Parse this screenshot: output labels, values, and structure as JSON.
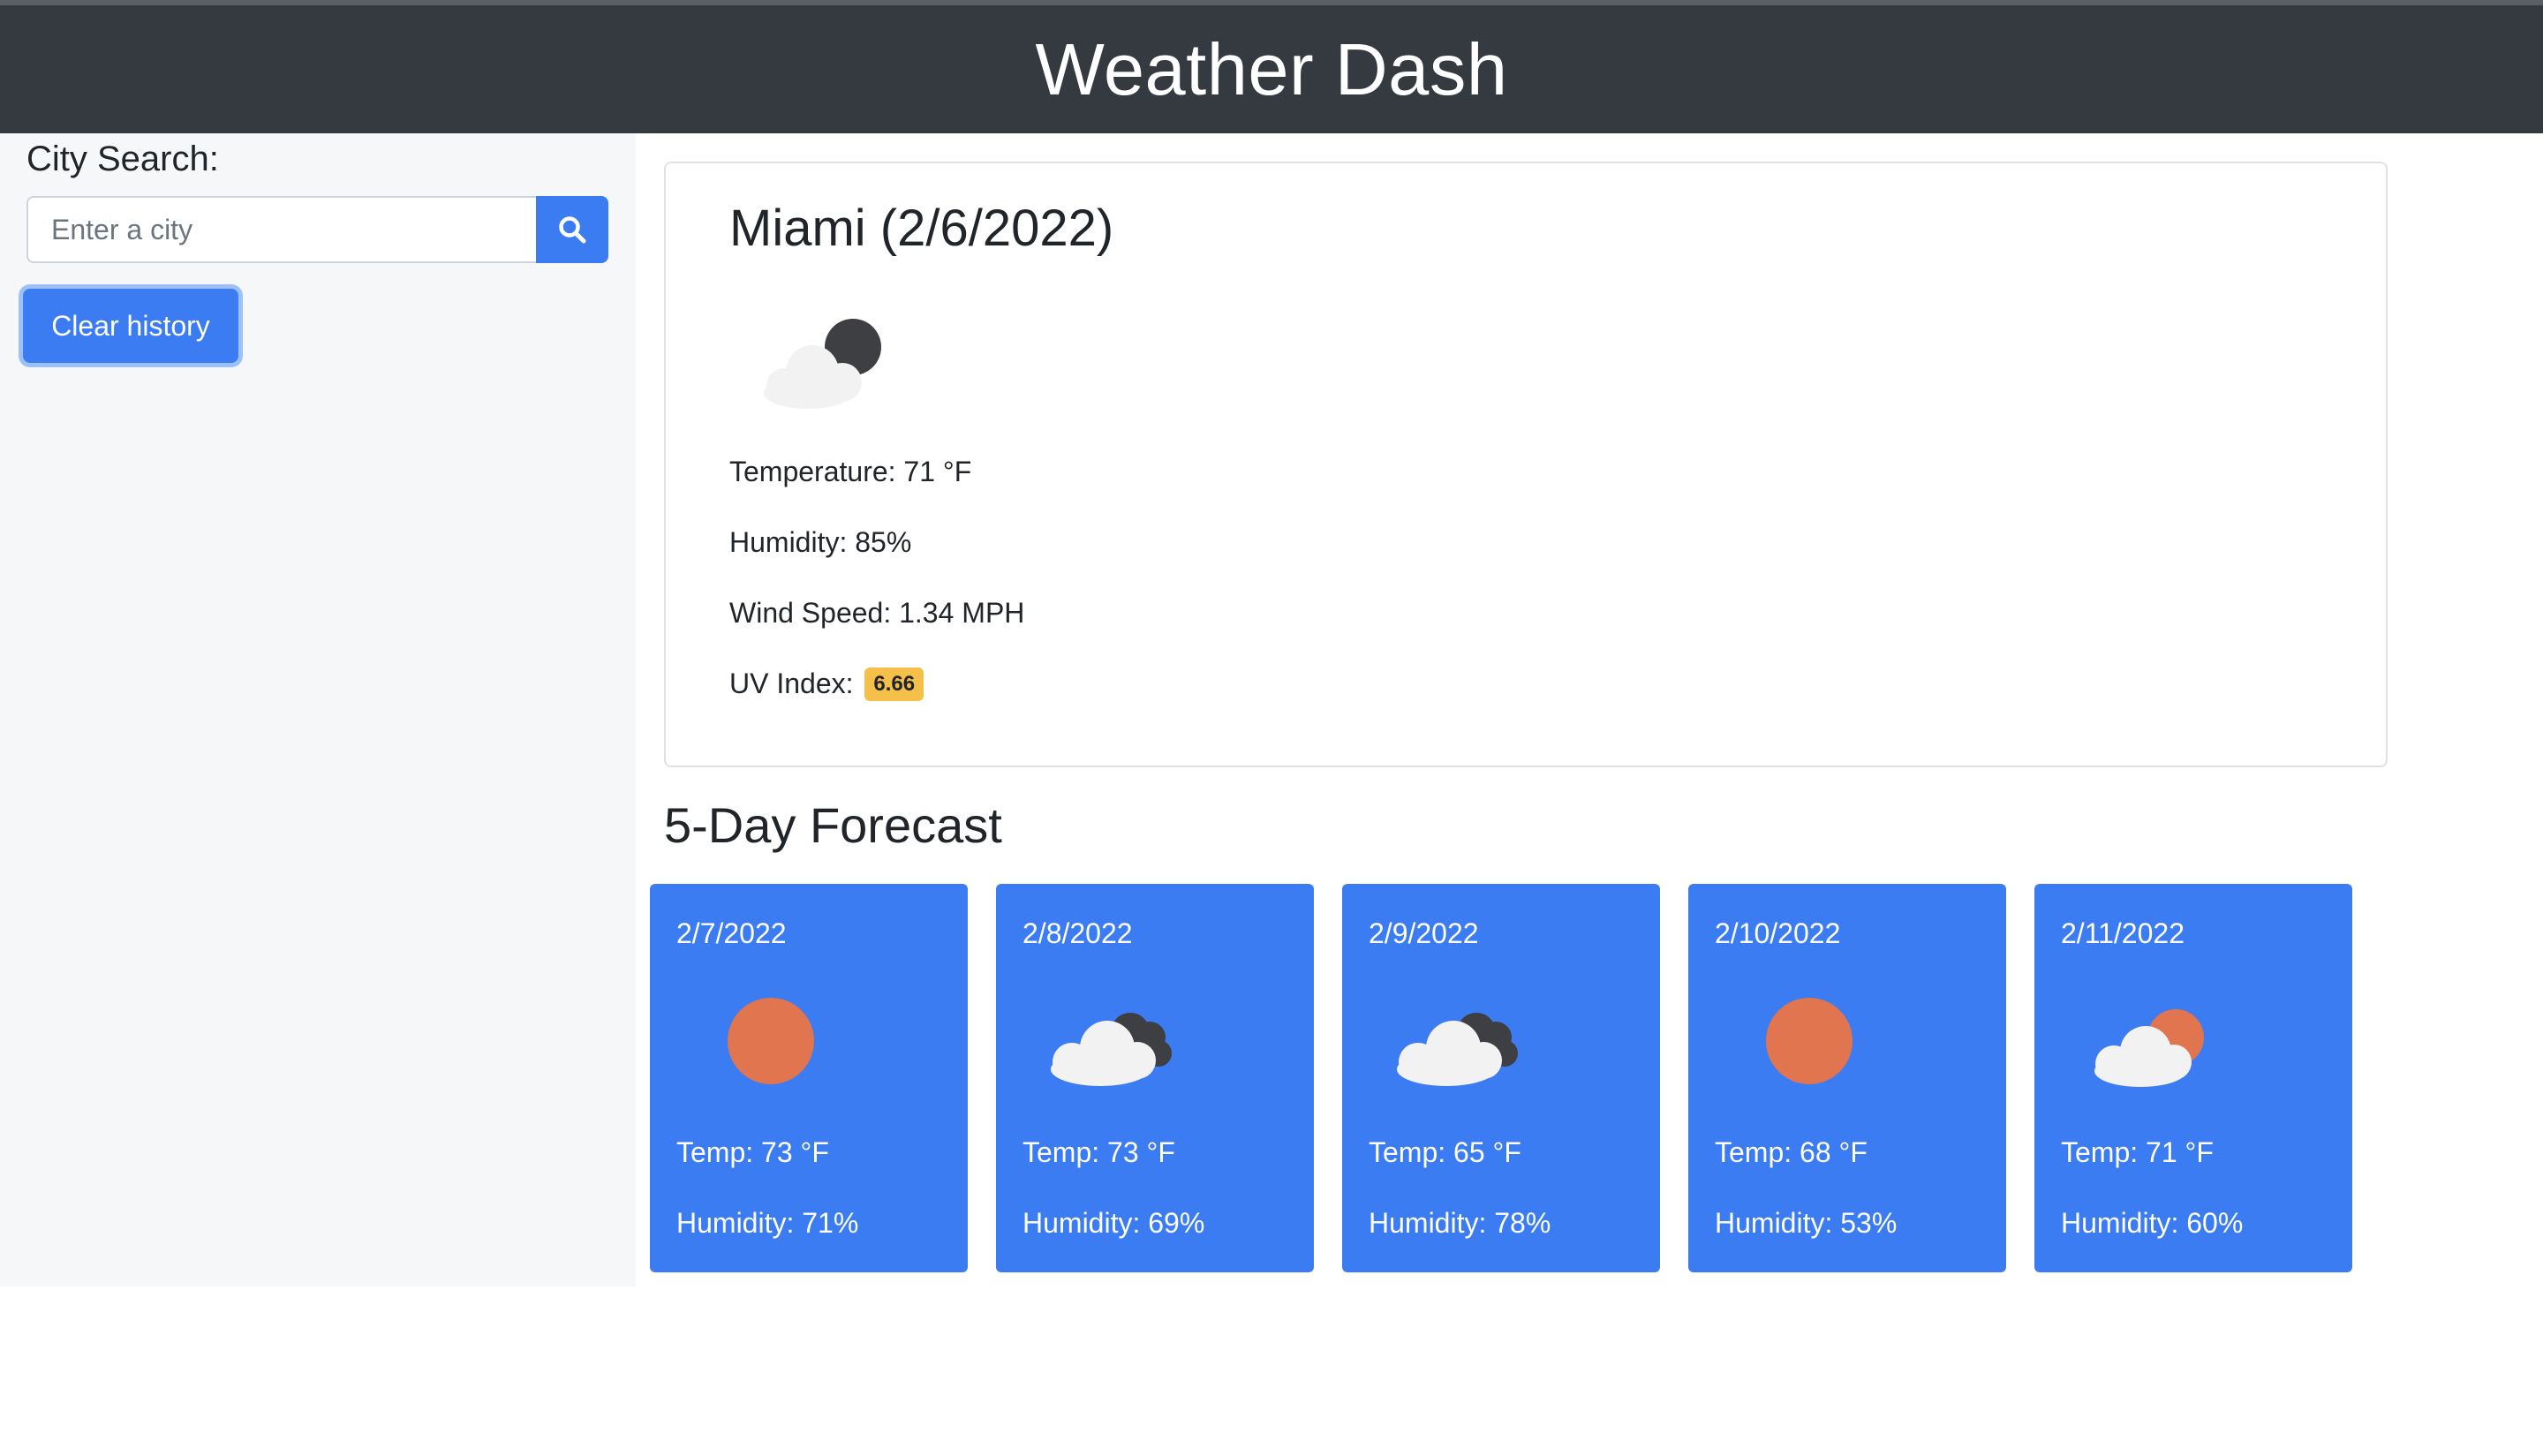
{
  "app": {
    "title": "Weather Dash"
  },
  "sidebar": {
    "search_label": "City Search:",
    "search_placeholder": "Enter a city",
    "search_value": "",
    "search_button_icon": "search-icon",
    "clear_label": "Clear history"
  },
  "current": {
    "title": "Miami (2/6/2022)",
    "icon": "cloudy-night-icon",
    "temperature": "Temperature: 71 °F",
    "humidity": "Humidity: 85%",
    "wind": "Wind Speed: 1.34 MPH",
    "uv_label": "UV Index:",
    "uv_value": "6.66",
    "uv_color": "#f5c04a"
  },
  "forecast": {
    "title": "5-Day Forecast",
    "days": [
      {
        "date": "2/7/2022",
        "icon": "sun-icon",
        "temp": "Temp: 73 °F",
        "humidity": "Humidity: 71%"
      },
      {
        "date": "2/8/2022",
        "icon": "cloudy-night-icon",
        "temp": "Temp: 73 °F",
        "humidity": "Humidity: 69%"
      },
      {
        "date": "2/9/2022",
        "icon": "cloudy-night-icon",
        "temp": "Temp: 65 °F",
        "humidity": "Humidity: 78%"
      },
      {
        "date": "2/10/2022",
        "icon": "sun-icon",
        "temp": "Temp: 68 °F",
        "humidity": "Humidity: 53%"
      },
      {
        "date": "2/11/2022",
        "icon": "partly-cloudy-icon",
        "temp": "Temp: 71 °F",
        "humidity": "Humidity: 60%"
      }
    ]
  },
  "colors": {
    "header_bg": "#343a40",
    "accent": "#3b7cf3",
    "sidebar_bg": "#f6f7f9",
    "sun": "#e07550",
    "moon": "#3e3f42"
  }
}
